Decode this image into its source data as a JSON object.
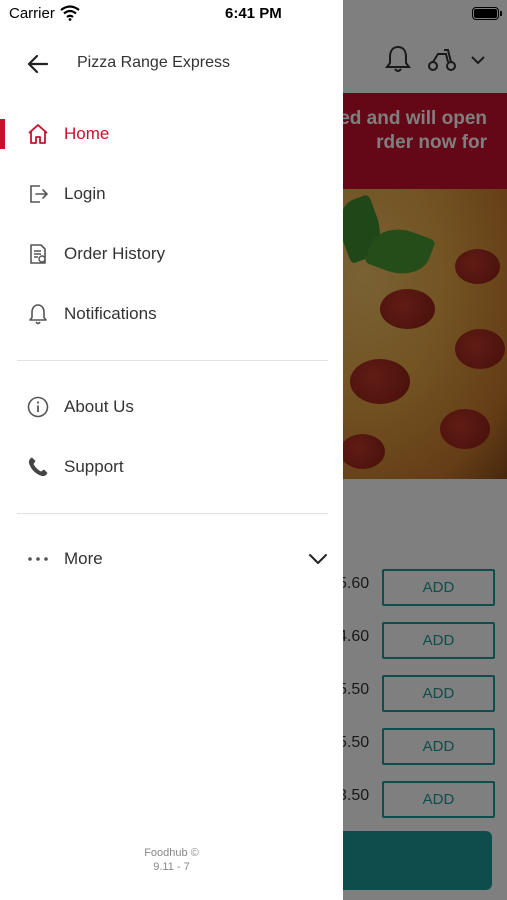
{
  "status_bar": {
    "carrier": "Carrier",
    "time": "6:41 PM"
  },
  "drawer": {
    "restaurant_name": "Pizza Range Express",
    "menu_items": [
      {
        "label": "Home",
        "icon": "home-icon",
        "active": true
      },
      {
        "label": "Login",
        "icon": "login-icon",
        "active": false
      },
      {
        "label": "Order History",
        "icon": "order-history-icon",
        "active": false
      },
      {
        "label": "Notifications",
        "icon": "bell-icon",
        "active": false
      }
    ],
    "secondary_items": [
      {
        "label": "About Us",
        "icon": "info-icon"
      },
      {
        "label": "Support",
        "icon": "phone-icon"
      }
    ],
    "more_label": "More",
    "footer_brand": "Foodhub ©",
    "footer_version": "9.11 - 7"
  },
  "background": {
    "banner_text": "ed and will open\nrder now for",
    "prices": [
      ".60",
      ".60",
      ".50",
      ".50",
      ".50"
    ],
    "price_prefixes": [
      "5",
      "4",
      "5",
      "5",
      "3"
    ],
    "add_label": "ADD"
  },
  "colors": {
    "accent": "#c8102e",
    "teal": "#1f9b98",
    "text": "#333333"
  }
}
